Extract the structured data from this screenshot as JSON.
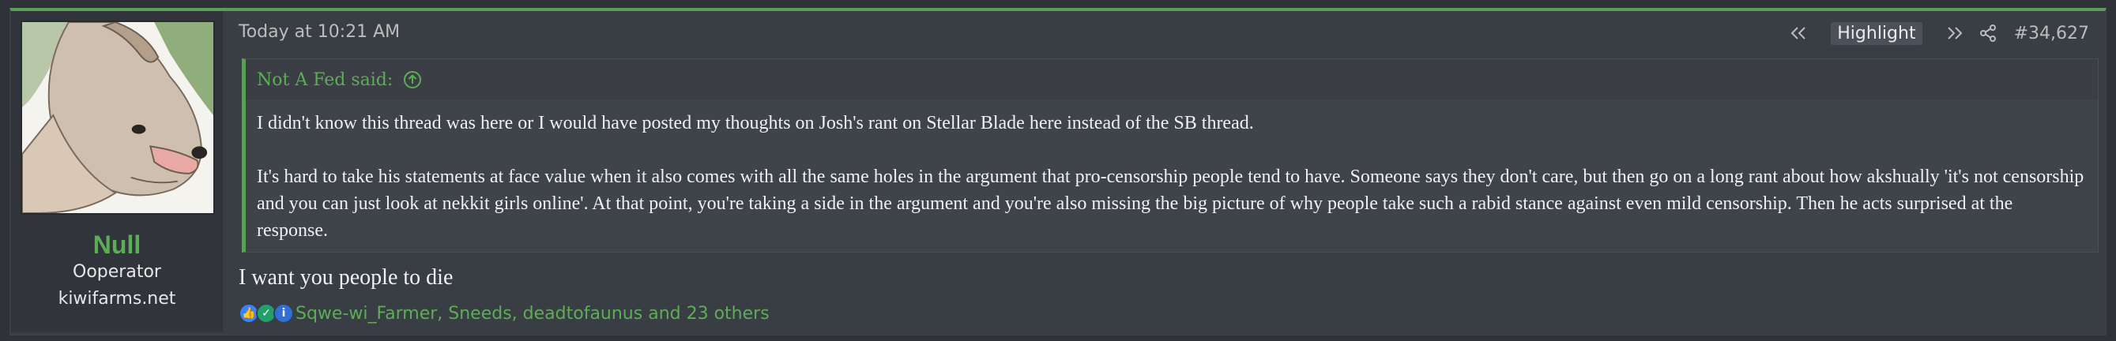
{
  "user": {
    "name": "Null",
    "title": "Ooperator",
    "site": "kiwifarms.net"
  },
  "post": {
    "date": "Today at 10:21 AM",
    "highlight_label": "Highlight",
    "number": "#34,627",
    "message": "I want you people to die"
  },
  "quote": {
    "author_line": "Not A Fed said:",
    "paragraphs": [
      "I didn't know this thread was here or I would have posted my thoughts on Josh's rant on Stellar Blade here instead of the SB thread.",
      "It's hard to take his statements at face value when it also comes with all the same holes in the argument that pro-censorship people tend to have. Someone says they don't care, but then go on a long rant about how akshually 'it's not censorship and you can just look at nekkit girls online'. At that point, you're taking a side in the argument and you're also missing the big picture of why people take such a rabid stance against even mild censorship. Then he acts surprised at the response."
    ]
  },
  "reactions": {
    "text": "Sqwe-wi_Farmer, Sneeds, deadtofaunus and 23 others",
    "icons": [
      "thumbs-up",
      "check",
      "info"
    ],
    "colors": {
      "thumbs-up": "#3b82f6",
      "check": "#22a06b",
      "info": "#2f6fd6"
    }
  },
  "colors": {
    "accent": "#5cae54",
    "post_bg": "#393d44",
    "page_bg": "#2f3339"
  }
}
